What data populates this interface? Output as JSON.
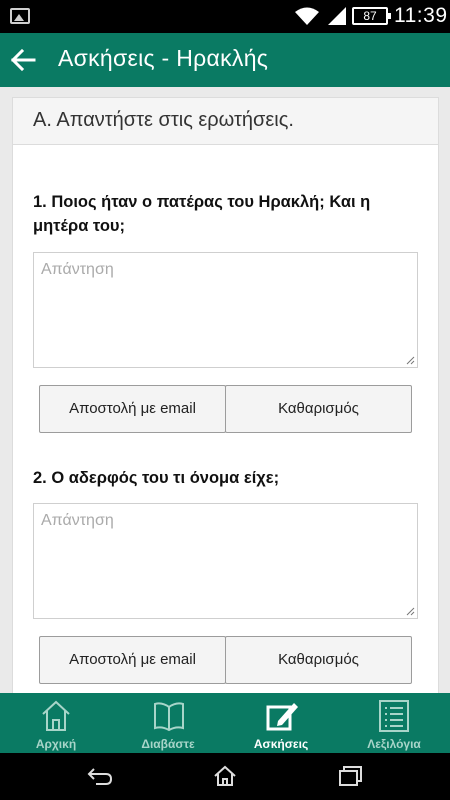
{
  "status_bar": {
    "battery": "87",
    "time": "11:39"
  },
  "app_bar": {
    "title": "Ασκήσεις - Ηρακλής"
  },
  "card": {
    "header": "Α. Απαντήστε στις ερωτήσεις."
  },
  "questions": [
    {
      "text": "1. Ποιος ήταν ο πατέρας του Ηρακλή; Και η μητέρα του;",
      "placeholder": "Απάντηση",
      "email_label": "Αποστολή με email",
      "clear_label": "Καθαρισμός"
    },
    {
      "text": "2. Ο αδερφός του τι όνομα είχε;",
      "placeholder": "Απάντηση",
      "email_label": "Αποστολή με email",
      "clear_label": "Καθαρισμός"
    }
  ],
  "bottom_nav": {
    "items": [
      {
        "label": "Αρχική",
        "icon": "home-icon",
        "active": false
      },
      {
        "label": "Διαβάστε",
        "icon": "book-icon",
        "active": false
      },
      {
        "label": "Ασκήσεις",
        "icon": "edit-icon",
        "active": true
      },
      {
        "label": "Λεξιλόγια",
        "icon": "list-icon",
        "active": false
      }
    ]
  },
  "colors": {
    "primary": "#0a7a63",
    "inactive_nav": "#a8d5c9"
  }
}
